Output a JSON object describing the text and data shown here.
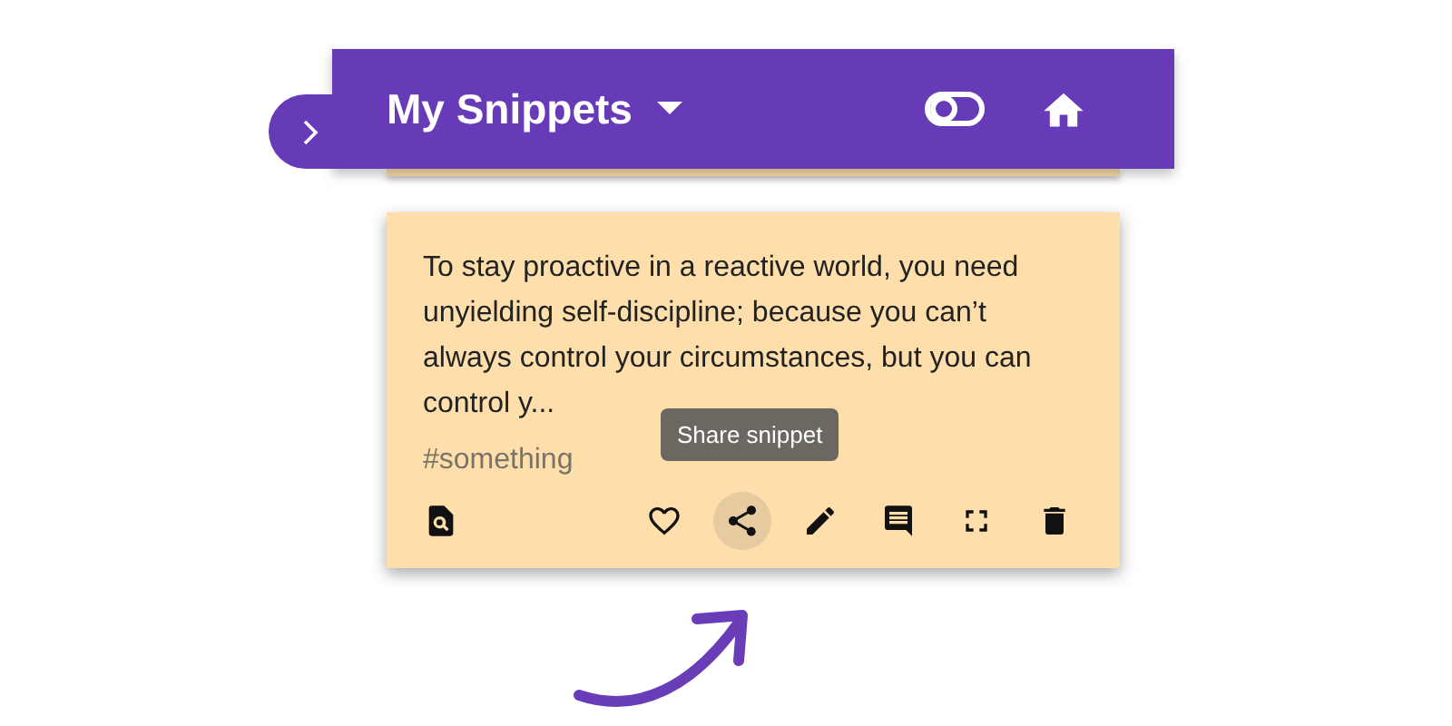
{
  "header": {
    "title": "My Snippets"
  },
  "snippet": {
    "text": "To stay proactive in a reactive world, you need unyielding self-discipline; because you can’t always control your circumstances, but you can control y...",
    "tag": "#something",
    "actions": [
      {
        "kind": "preview",
        "selected": false
      },
      {
        "kind": "favorite",
        "selected": false
      },
      {
        "kind": "share",
        "selected": true
      },
      {
        "kind": "edit",
        "selected": false
      },
      {
        "kind": "comment",
        "selected": false
      },
      {
        "kind": "fullscreen",
        "selected": false
      },
      {
        "kind": "delete",
        "selected": false
      }
    ],
    "tooltip": "Share snippet"
  }
}
